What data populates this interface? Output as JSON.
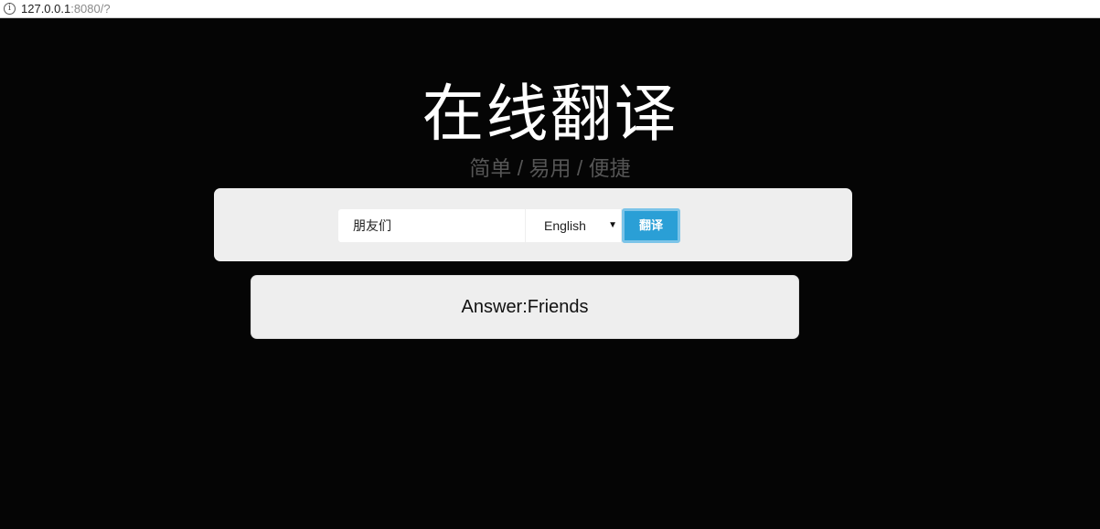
{
  "browser": {
    "url_host": "127.0.0.1",
    "url_rest": ":8080/?"
  },
  "header": {
    "title": "在线翻译",
    "subtitle": "简单 / 易用 / 便捷"
  },
  "form": {
    "input_value": "朋友们",
    "language_selected": "English",
    "translate_label": "翻译"
  },
  "result": {
    "answer": "Answer:Friends"
  },
  "colors": {
    "background": "#050505",
    "panel": "#eeeeee",
    "button": "#2a9fd6"
  }
}
